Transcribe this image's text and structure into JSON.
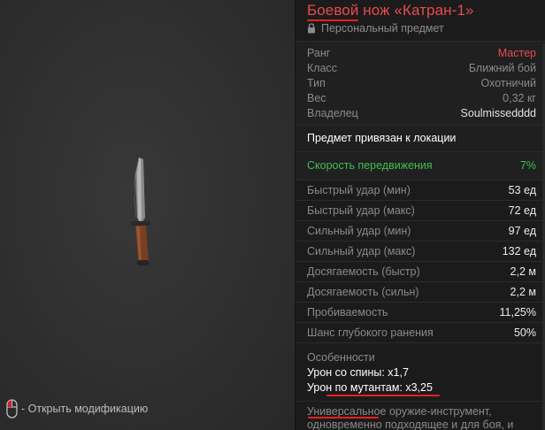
{
  "item": {
    "name": "Боевой нож «Катран-1»",
    "personal_label": "Персональный предмет"
  },
  "props": [
    {
      "k": "Ранг",
      "v": "Мастер"
    },
    {
      "k": "Класс",
      "v": "Ближний бой"
    },
    {
      "k": "Тип",
      "v": "Охотничий"
    },
    {
      "k": "Вес",
      "v": "0,32 кг"
    },
    {
      "k": "Владелец",
      "v": "Soulmissedddd"
    }
  ],
  "bound_text": "Предмет привязан к локации",
  "speed": {
    "k": "Скорость передвижения",
    "v": "7%"
  },
  "stats": [
    {
      "k": "Быстрый удар (мин)",
      "v": "53 ед"
    },
    {
      "k": "Быстрый удар (макс)",
      "v": "72 ед"
    },
    {
      "k": "Сильный удар (мин)",
      "v": "97 ед"
    },
    {
      "k": "Сильный удар (макс)",
      "v": "132 ед"
    },
    {
      "k": "Досягаемость (быстр)",
      "v": "2,2 м"
    },
    {
      "k": "Досягаемость (сильн)",
      "v": "2,2 м"
    },
    {
      "k": "Пробиваемость",
      "v": "11,25%"
    },
    {
      "k": "Шанс глубокого ранения",
      "v": "50%"
    }
  ],
  "features": {
    "heading": "Особенности",
    "lines": [
      "Урон со спины: x1,7",
      "Урон по мутантам: x3,25"
    ]
  },
  "description": "Универсальное оружие-инструмент, одновременно подходящее и для боя, и для выживания. Создан по заказу",
  "hint": {
    "text": "- Открыть модификацию",
    "icon": "mouse-icon"
  },
  "colors": {
    "accent": "#e84a50",
    "green": "#3fbf4f",
    "red_mark": "#e82020"
  }
}
